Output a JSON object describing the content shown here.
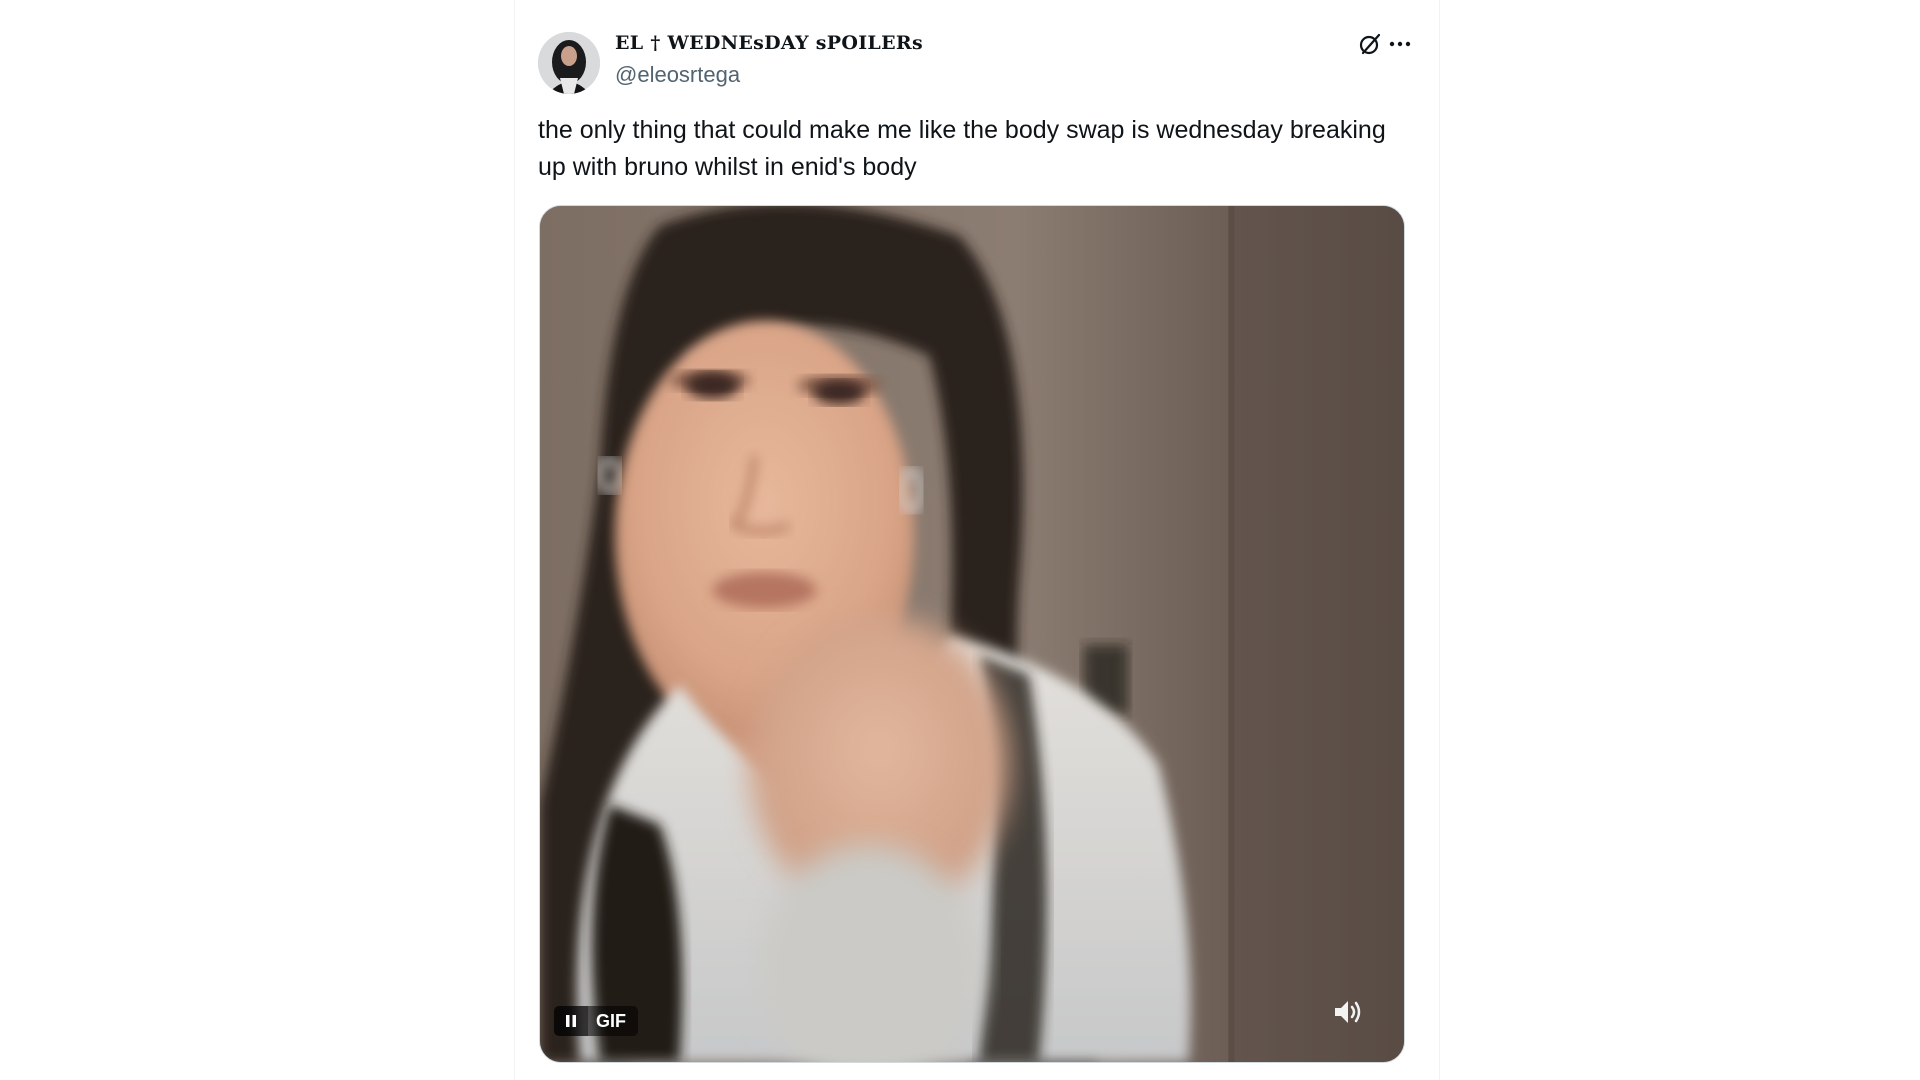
{
  "tweet": {
    "display_name": "EL † WEDNEsDAY sPOILERs",
    "handle": "@eleosrtega",
    "text": "the only thing that could make me like the body swap is wednesday breaking up with bruno whilst in enid's body",
    "icons": {
      "avatar": "avatar",
      "header_action": "grok-icon",
      "more": "more-dots-icon"
    }
  },
  "media": {
    "type": "gif",
    "badge_label": "GIF",
    "icons": {
      "pause": "pause-icon",
      "volume": "volume-icon"
    }
  },
  "colors": {
    "text_primary": "#0f1419",
    "text_secondary": "#536471",
    "border": "#eff3f4"
  }
}
